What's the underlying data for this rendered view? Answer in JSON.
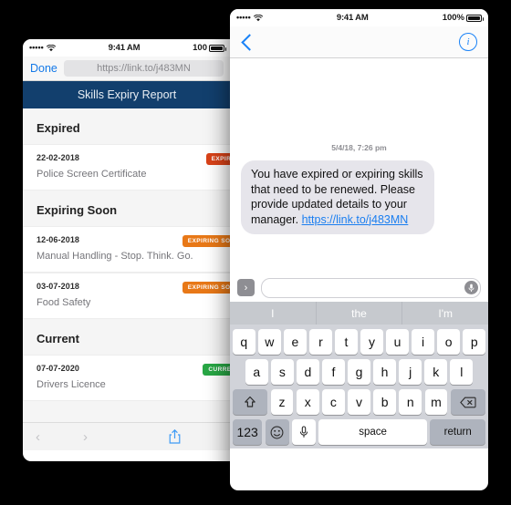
{
  "left_phone": {
    "status_bar": {
      "signal": "•••••",
      "wifi": "wifi-icon",
      "time": "9:41 AM",
      "battery": "100"
    },
    "safari": {
      "done_label": "Done",
      "url": "https://link.to/j483MN",
      "back_icon": "chevron-left-icon",
      "forward_icon": "chevron-right-icon",
      "share_icon": "share-icon"
    },
    "app_header_title": "Skills Expiry Report",
    "sections": [
      {
        "title": "Expired",
        "rows": [
          {
            "date": "22-02-2018",
            "name": "Police Screen Certificate",
            "badge": "EXPIRED",
            "badge_color": "#d94218"
          }
        ]
      },
      {
        "title": "Expiring Soon",
        "rows": [
          {
            "date": "12-06-2018",
            "name": "Manual Handling - Stop. Think. Go.",
            "badge": "EXPIRING SOON",
            "badge_color": "#e87817"
          },
          {
            "date": "03-07-2018",
            "name": "Food Safety",
            "badge": "EXPIRING SOON",
            "badge_color": "#e87817"
          }
        ]
      },
      {
        "title": "Current",
        "rows": [
          {
            "date": "07-07-2020",
            "name": "Drivers Licence",
            "badge": "CURRENT",
            "badge_color": "#28a745"
          }
        ]
      }
    ]
  },
  "right_phone": {
    "status_bar": {
      "signal": "•••••",
      "wifi": "wifi-icon",
      "time": "9:41 AM",
      "battery": "100%"
    },
    "nav": {
      "back_icon": "chevron-left-icon",
      "info_icon": "info-icon",
      "info_glyph": "i"
    },
    "conversation": {
      "timestamp": "5/4/18, 7:26 pm",
      "message_text": "You have expired or expiring skills that need to be renewed. Please provide updated details to your manager. ",
      "message_link": "https://link.to/j483MN"
    },
    "input_bar": {
      "app_button_icon": "chevron-right-icon",
      "app_button_glyph": "›",
      "placeholder": "",
      "value": "",
      "mic_icon": "microphone-icon"
    },
    "keyboard": {
      "predictions": [
        "I",
        "the",
        "I'm"
      ],
      "row1": [
        "q",
        "w",
        "e",
        "r",
        "t",
        "y",
        "u",
        "i",
        "o",
        "p"
      ],
      "row2": [
        "a",
        "s",
        "d",
        "f",
        "g",
        "h",
        "j",
        "k",
        "l"
      ],
      "row3": [
        "z",
        "x",
        "c",
        "v",
        "b",
        "n",
        "m"
      ],
      "shift_icon": "shift-icon",
      "backspace_icon": "backspace-icon",
      "numbers_label": "123",
      "emoji_icon": "emoji-icon",
      "dictation_icon": "microphone-icon",
      "space_label": "space",
      "return_label": "return"
    }
  },
  "colors": {
    "app_header": "#123f6d",
    "ios_blue": "#1a82f7",
    "bubble_gray": "#e6e5eb",
    "keyboard_bg": "#d1d3d9"
  }
}
